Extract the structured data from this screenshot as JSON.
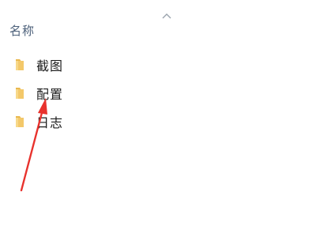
{
  "header": {
    "name_column_label": "名称",
    "sort_indicator_icon": "chevron-up-icon"
  },
  "items": [
    {
      "label": "截图",
      "icon": "folder-icon"
    },
    {
      "label": "配置",
      "icon": "folder-icon"
    },
    {
      "label": "日志",
      "icon": "folder-icon"
    }
  ],
  "colors": {
    "folder": "#f3c86a",
    "annotation": "#e8322d"
  }
}
